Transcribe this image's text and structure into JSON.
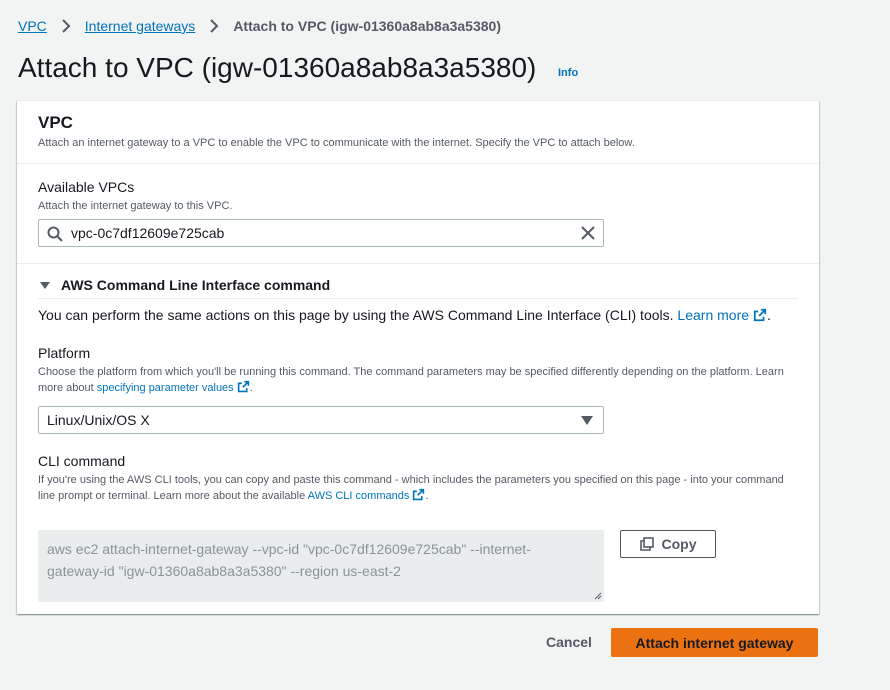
{
  "breadcrumb": {
    "root": "VPC",
    "parent": "Internet gateways",
    "current": "Attach to VPC (igw-01360a8ab8a3a5380)"
  },
  "page": {
    "title": "Attach to VPC (igw-01360a8ab8a3a5380)",
    "info_label": "Info"
  },
  "vpc_section": {
    "title": "VPC",
    "description": "Attach an internet gateway to a VPC to enable the VPC to communicate with the internet. Specify the VPC to attach below."
  },
  "available_vpcs": {
    "label": "Available VPCs",
    "description": "Attach the internet gateway to this VPC.",
    "value": "vpc-0c7df12609e725cab"
  },
  "cli_section": {
    "header": "AWS Command Line Interface command",
    "intro": "You can perform the same actions on this page by using the AWS Command Line Interface (CLI) tools.",
    "intro_link": "Learn more",
    "platform": {
      "label": "Platform",
      "description": "Choose the platform from which you'll be running this command. The command parameters may be specified differently depending on the platform. Learn more about",
      "description_link": "specifying parameter values",
      "selected": "Linux/Unix/OS X"
    },
    "cli_command": {
      "label": "CLI command",
      "description": "If you're using the AWS CLI tools, you can copy and paste this command - which includes the parameters you specified on this page - into your command line prompt or terminal. Learn more about the available",
      "description_link": "AWS CLI commands",
      "command": "aws ec2 attach-internet-gateway --vpc-id \"vpc-0c7df12609e725cab\" --internet-gateway-id \"igw-01360a8ab8a3a5380\" --region us-east-2",
      "copy_label": "Copy"
    }
  },
  "footer": {
    "cancel_label": "Cancel",
    "submit_label": "Attach internet gateway"
  },
  "colors": {
    "link": "#0073bb",
    "primary": "#ec7211",
    "background": "#f2f3f3"
  },
  "icons": {
    "search": "search-icon",
    "clear": "close-icon",
    "caret": "caret-down-icon",
    "external": "external-link-icon",
    "copy": "copy-icon",
    "select_arrow": "caret-down-icon"
  }
}
